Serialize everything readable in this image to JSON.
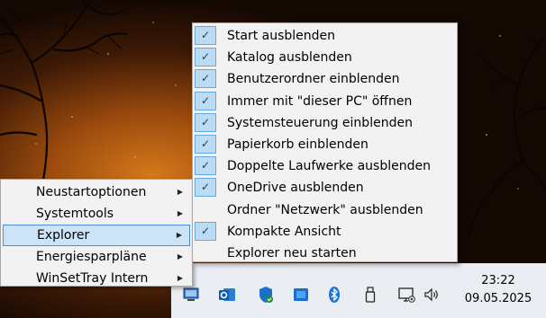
{
  "main_menu": {
    "items": [
      {
        "label": "Neustartoptionen",
        "active": false
      },
      {
        "label": "Systemtools",
        "active": false
      },
      {
        "label": "Explorer",
        "active": true
      },
      {
        "label": "Energiesparpläne",
        "active": false
      },
      {
        "label": "WinSetTray Intern",
        "active": false
      }
    ],
    "arrow_glyph": "▶"
  },
  "explorer_submenu": {
    "items": [
      {
        "label": "Start ausblenden",
        "checked": true
      },
      {
        "label": "Katalog ausblenden",
        "checked": true
      },
      {
        "label": "Benutzerordner einblenden",
        "checked": true
      },
      {
        "label": "Immer mit \"dieser PC\" öffnen",
        "checked": true
      },
      {
        "label": "Systemsteuerung einblenden",
        "checked": true
      },
      {
        "label": "Papierkorb einblenden",
        "checked": true
      },
      {
        "label": "Doppelte Laufwerke ausblenden",
        "checked": true
      },
      {
        "label": "OneDrive ausblenden",
        "checked": true
      },
      {
        "label": "Ordner \"Netzwerk\" ausblenden",
        "checked": false
      },
      {
        "label": "Kompakte Ansicht",
        "checked": true
      },
      {
        "label": "Explorer neu starten",
        "checked": false
      }
    ],
    "check_glyph": "✓"
  },
  "taskbar": {
    "tray_icons": [
      "winsettray-icon",
      "outlook-icon",
      "defender-shield-icon",
      "store-icon",
      "bluetooth-icon",
      "usb-drive-icon",
      "network-monitor-icon",
      "volume-icon"
    ],
    "clock": {
      "time": "23:22",
      "date": "09.05.2025"
    }
  },
  "colors": {
    "menu_bg": "#f2f2f2",
    "highlight_bg": "#cce4f7",
    "highlight_border": "#4c8fd6",
    "check_bg": "#bcdcf4",
    "taskbar_bg": "#eaeef2"
  }
}
